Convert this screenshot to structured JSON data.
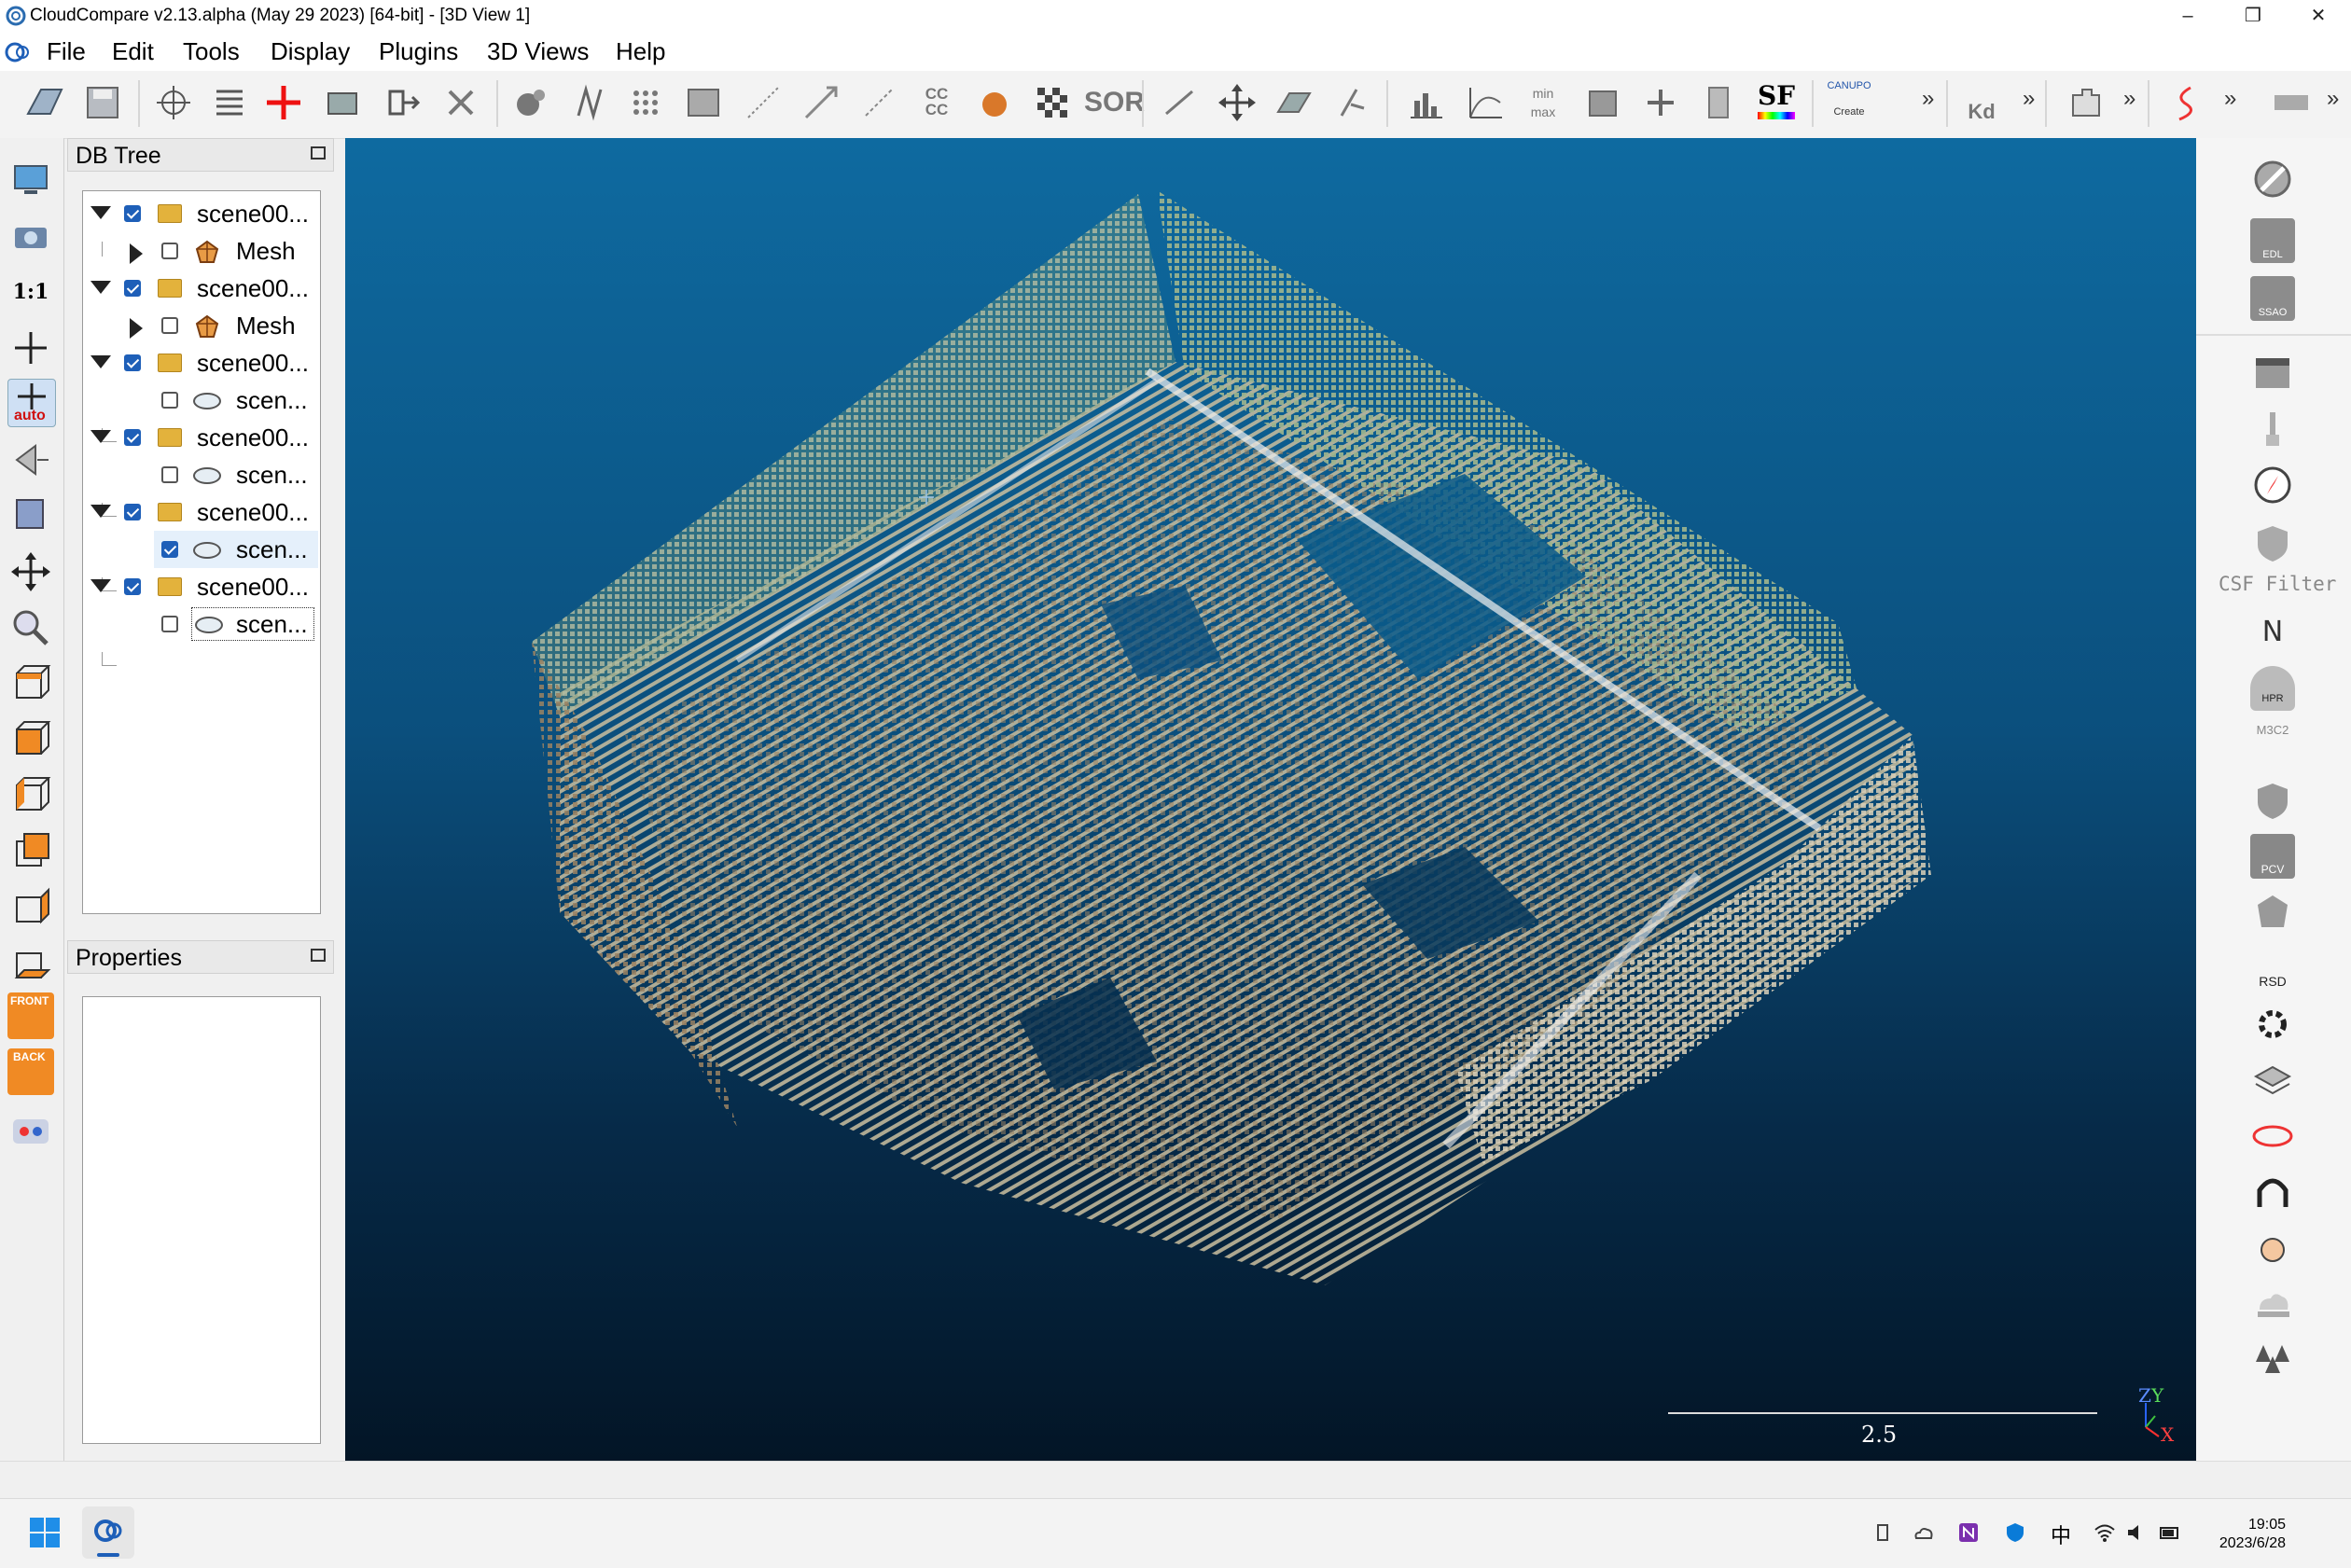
{
  "window": {
    "title": "CloudCompare v2.13.alpha (May 29 2023) [64-bit] - [3D View 1]",
    "controls": [
      "–",
      "❐",
      "✕"
    ]
  },
  "menu": [
    "File",
    "Edit",
    "Tools",
    "Display",
    "Plugins",
    "3D Views",
    "Help"
  ],
  "toolbar": {
    "text_icons": {
      "cccc": "CC\nCC",
      "sor": "SOR",
      "sf": "SF",
      "canupo": "CANUPO",
      "create": "Create",
      "kd": "Kd",
      "minmax_top": "min",
      "minmax_bottom": "max"
    },
    "more": "»"
  },
  "left_toolbar": {
    "ratio_label": "1:1",
    "auto_label": "auto",
    "front_label": "FRONT",
    "back_label": "BACK"
  },
  "db_tree": {
    "title": "DB Tree",
    "rows": [
      {
        "label": "scene00...",
        "type": "group",
        "expanded": true,
        "checked": true
      },
      {
        "label": "Mesh",
        "type": "mesh",
        "expanded": false,
        "checked": false
      },
      {
        "label": "scene00...",
        "type": "group",
        "expanded": true,
        "checked": true
      },
      {
        "label": "Mesh",
        "type": "mesh",
        "expanded": false,
        "checked": false
      },
      {
        "label": "scene00...",
        "type": "group",
        "expanded": true,
        "checked": true
      },
      {
        "label": "scen...",
        "type": "cloud",
        "checked": false
      },
      {
        "label": "scene00...",
        "type": "group",
        "expanded": true,
        "checked": true
      },
      {
        "label": "scen...",
        "type": "cloud",
        "checked": false
      },
      {
        "label": "scene00...",
        "type": "group",
        "expanded": true,
        "checked": true
      },
      {
        "label": "scen...",
        "type": "cloud",
        "checked": true,
        "highlighted": true
      },
      {
        "label": "scene00...",
        "type": "group",
        "expanded": true,
        "checked": true
      },
      {
        "label": "scen...",
        "type": "cloud",
        "checked": false,
        "focused": true
      }
    ]
  },
  "properties": {
    "title": "Properties"
  },
  "view3d": {
    "scale_label": "2.5",
    "axis_labels": {
      "z": "Z",
      "y": "Y",
      "x": "X"
    }
  },
  "right_toolbar": {
    "csf_label": "CSF Filter",
    "edl": "EDL",
    "ssao": "SSAO",
    "n_label": "N",
    "hpr": "HPR",
    "m3c2": "M3C2",
    "pcv": "PCV",
    "rsd": "RSD"
  },
  "taskbar": {
    "time": "19:05",
    "date": "2023/6/28",
    "ime": "中"
  },
  "colors": {
    "accent": "#1e5fb8",
    "view_top": "#0e6aa0",
    "view_bottom": "#031526"
  }
}
